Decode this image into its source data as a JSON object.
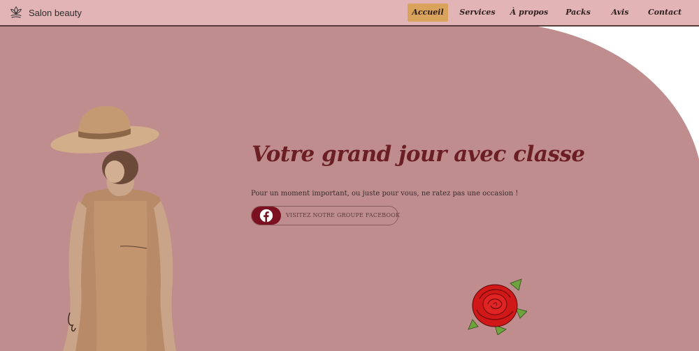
{
  "brand": {
    "name": "Salon beauty",
    "logo_icon": "lotus-logo-icon"
  },
  "nav": {
    "items": [
      {
        "label": "Accueil",
        "active": true
      },
      {
        "label": "Services",
        "active": false
      },
      {
        "label": "À propos",
        "active": false
      },
      {
        "label": "Packs",
        "active": false
      },
      {
        "label": "Avis",
        "active": false
      },
      {
        "label": "Contact",
        "active": false
      }
    ]
  },
  "hero": {
    "title": "Votre grand jour avec classe",
    "subtitle": "Pour un moment important, ou juste pour vous, ne ratez pas une occasion !",
    "cta": {
      "label": "VISITEZ NOTRE GROUPE FACEBOOK",
      "icon": "facebook-icon"
    }
  },
  "illustrations": {
    "left": "woman-in-hat-image",
    "right": "red-rose-image"
  },
  "colors": {
    "page_background": "#bf8d8e",
    "navbar_background": "#e3b4b5",
    "active_nav": "#d9a35b",
    "title": "#6b1f24",
    "cta_pill": "#7a1020",
    "curve_fill": "#ffffff"
  }
}
